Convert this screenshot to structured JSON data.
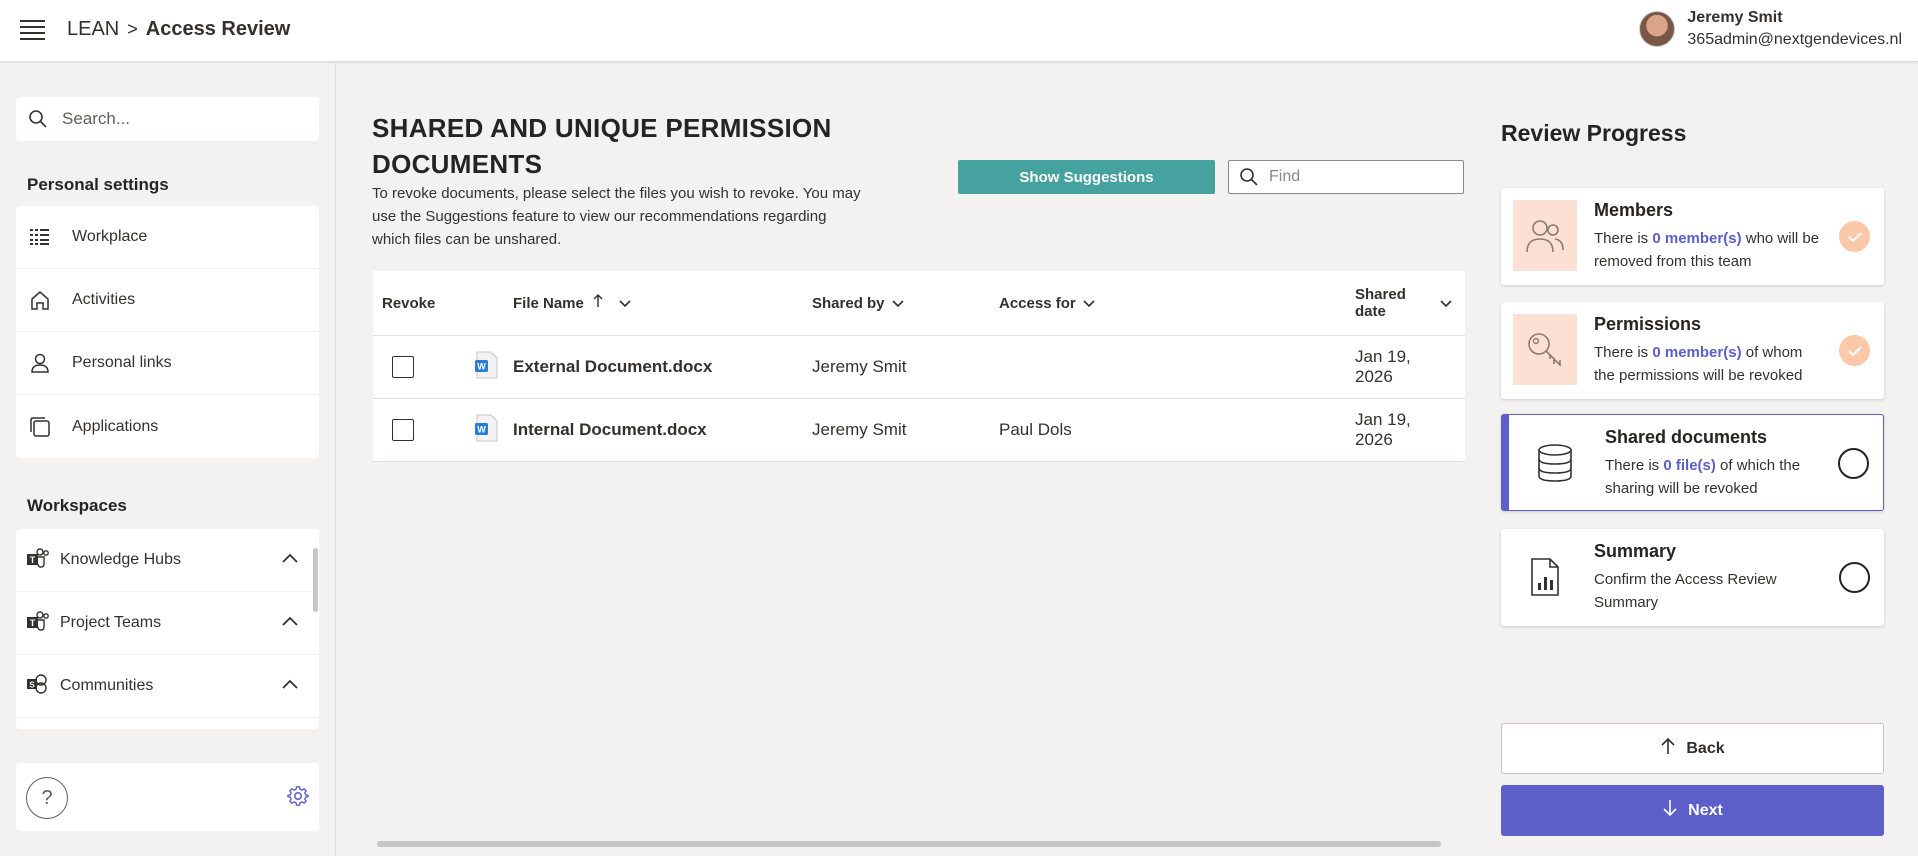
{
  "header": {
    "breadcrumb_root": "LEAN",
    "breadcrumb_sep": ">",
    "breadcrumb_current": "Access Review",
    "user_name": "Jeremy Smit",
    "user_email": "365admin@nextgendevices.nl"
  },
  "sidebar": {
    "search_placeholder": "Search...",
    "personal_title": "Personal settings",
    "personal_items": [
      {
        "label": "Workplace",
        "icon": "grid-list-icon"
      },
      {
        "label": "Activities",
        "icon": "home-icon"
      },
      {
        "label": "Personal links",
        "icon": "person-icon"
      },
      {
        "label": "Applications",
        "icon": "apps-icon"
      }
    ],
    "workspaces_title": "Workspaces",
    "workspace_items": [
      {
        "label": "Knowledge Hubs",
        "icon": "teams-icon"
      },
      {
        "label": "Project Teams",
        "icon": "teams-icon"
      },
      {
        "label": "Communities",
        "icon": "communities-icon"
      }
    ],
    "help_label": "?"
  },
  "main": {
    "title": "SHARED AND UNIQUE PERMISSION DOCUMENTS",
    "description": "To revoke documents, please select the files you wish to revoke. You may use the Suggestions feature to view our recommendations regarding which files can be unshared.",
    "suggestions_button": "Show Suggestions",
    "find_placeholder": "Find",
    "columns": {
      "revoke": "Revoke",
      "file_name": "File Name",
      "shared_by": "Shared by",
      "access_for": "Access for",
      "shared_date": "Shared date"
    },
    "rows": [
      {
        "file_name": "External Document.docx",
        "shared_by": "Jeremy Smit",
        "access_for": "",
        "shared_date": "Jan 19, 2026"
      },
      {
        "file_name": "Internal Document.docx",
        "shared_by": "Jeremy Smit",
        "access_for": "Paul Dols",
        "shared_date": "Jan 19, 2026"
      }
    ]
  },
  "review": {
    "title": "Review Progress",
    "steps": [
      {
        "title": "Members",
        "desc_pre": "There is ",
        "desc_highlight": "0 member(s)",
        "desc_post": " who will be removed from this team",
        "status": "done"
      },
      {
        "title": "Permissions",
        "desc_pre": "There is ",
        "desc_highlight": "0 member(s)",
        "desc_post": " of whom the permissions will be revoked",
        "status": "done"
      },
      {
        "title": "Shared documents",
        "desc_pre": "There is ",
        "desc_highlight": "0 file(s)",
        "desc_post": " of which the sharing will be revoked",
        "status": "active"
      },
      {
        "title": "Summary",
        "desc_pre": "Confirm the Access Review Summary",
        "desc_highlight": "",
        "desc_post": "",
        "status": "pending"
      }
    ],
    "back_label": "Back",
    "next_label": "Next"
  },
  "colors": {
    "accent": "#5b5fc7",
    "suggest_button": "#45a29e",
    "step_done": "#fbc9a9",
    "step_icon_bg": "#fde0d4"
  }
}
